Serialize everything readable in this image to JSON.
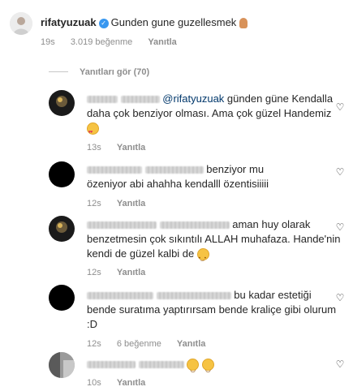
{
  "post": {
    "username": "rifatyuzuak",
    "verified_glyph": "✓",
    "caption": "Gunden gune guzellesmek",
    "time": "19s",
    "likes": "3.019 beğenme",
    "reply": "Yanıtla"
  },
  "view_replies": "Yanıtları gör (70)",
  "comments": [
    {
      "mention": "@rifatyuzuak",
      "line1_rest": " günden güne Kendalla",
      "line2": "daha çok benziyor olması. Ama çok güzel Handemiz",
      "time": "13s",
      "reply": "Yanıtla"
    },
    {
      "line1": "benziyor mu",
      "line2": "özeniyor abi ahahha kendalll özentisiiiii",
      "time": "12s",
      "reply": "Yanıtla"
    },
    {
      "line1": "aman huy olarak",
      "line2": "benzetmesin çok sıkıntılı ALLAH muhafaza. Hande'nin",
      "line3": "kendi de güzel kalbi de",
      "time": "12s",
      "reply": "Yanıtla"
    },
    {
      "line1": "bu kadar estetiği",
      "line2": "bende suratıma yaptırırsam bende kraliçe gibi olurum",
      "line3": ":D",
      "time": "12s",
      "likes": "6 beğenme",
      "reply": "Yanıtla"
    },
    {
      "time": "10s",
      "reply": "Yanıtla"
    }
  ],
  "icons": {
    "heart": "♡"
  }
}
